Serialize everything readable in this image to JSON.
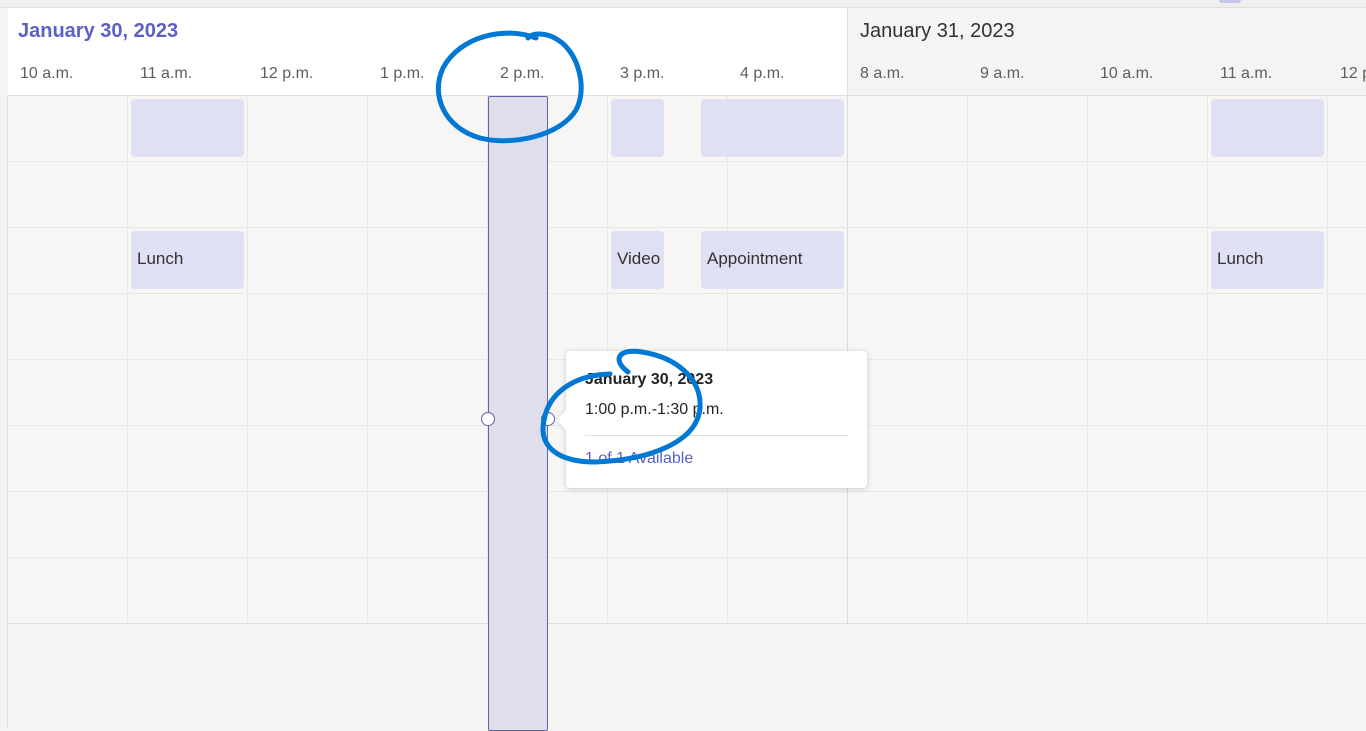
{
  "days": [
    {
      "date": "January 30, 2023",
      "hours": [
        "10 a.m.",
        "11 a.m.",
        "12 p.m.",
        "1 p.m.",
        "2 p.m.",
        "3 p.m.",
        "4 p.m."
      ]
    },
    {
      "date": "January 31, 2023",
      "hours": [
        "8 a.m.",
        "9 a.m.",
        "10 a.m.",
        "11 a.m.",
        "12 p.m."
      ]
    }
  ],
  "events": {
    "jan30_11am_row1": "",
    "jan30_11am_row3": "Lunch",
    "jan30_3pm_row1": "",
    "jan30_3pm_row3": "Video",
    "jan30_4pm_row1": "",
    "jan30_4pm_row3": "Appointment",
    "jan31_11am_row1": "",
    "jan31_11am_row3": "Lunch"
  },
  "popup": {
    "date": "January 30, 2023",
    "time_range": "1:00 p.m.-1:30 p.m.",
    "availability": "1 of 1 Available"
  },
  "colors": {
    "accent": "#5b5fc7",
    "event_fill": "#e0e0f5",
    "selection_fill": "#dfdeeb",
    "selection_border": "#6264a7",
    "annotation_ink": "#0078d4"
  }
}
